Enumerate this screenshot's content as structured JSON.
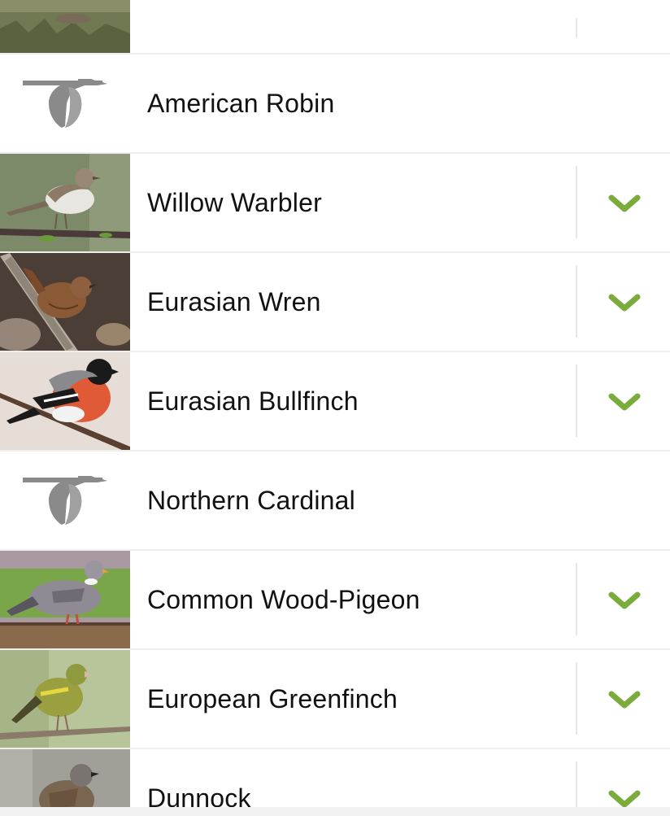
{
  "species_list": {
    "items": [
      {
        "name": "",
        "photo": "bird-photo",
        "checked": false,
        "partial": true
      },
      {
        "name": "American Robin",
        "photo": "placeholder-bird-logo-icon",
        "checked": false
      },
      {
        "name": "Willow Warbler",
        "photo": "bird-photo",
        "checked": true
      },
      {
        "name": "Eurasian Wren",
        "photo": "bird-photo",
        "checked": true
      },
      {
        "name": "Eurasian Bullfinch",
        "photo": "bird-photo",
        "checked": true
      },
      {
        "name": "Northern Cardinal",
        "photo": "placeholder-bird-logo-icon",
        "checked": false
      },
      {
        "name": "Common Wood-Pigeon",
        "photo": "bird-photo",
        "checked": true
      },
      {
        "name": "European Greenfinch",
        "photo": "bird-photo",
        "checked": true
      },
      {
        "name": "Dunnock",
        "photo": "bird-photo",
        "checked": true
      }
    ],
    "check_color": "#7aac3c",
    "logo_color": "#8a8a8a"
  }
}
